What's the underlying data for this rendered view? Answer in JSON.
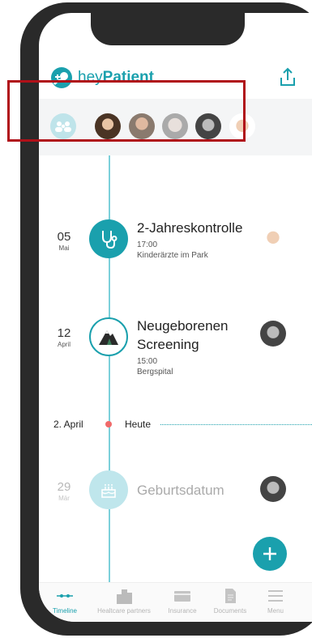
{
  "app": {
    "brand_prefix": "hey",
    "brand_bold": "Patient"
  },
  "header": {
    "share_icon": "share-icon"
  },
  "profiles": [
    {
      "name": "family",
      "icon": "family-icon"
    },
    {
      "name": "profile-1"
    },
    {
      "name": "profile-2"
    },
    {
      "name": "profile-3"
    },
    {
      "name": "profile-4"
    },
    {
      "name": "profile-5"
    }
  ],
  "timeline": {
    "events": [
      {
        "day": "05",
        "month": "Mai",
        "icon": "stethoscope-icon",
        "title": "2-Jahreskontrolle",
        "time": "17:00",
        "place": "Kinderärzte im Park"
      },
      {
        "day": "12",
        "month": "April",
        "icon": "mountain-icon",
        "title_line1": "Neugeborenen",
        "title_line2": "Screening",
        "time": "15:00",
        "place": "Bergspital"
      },
      {
        "day": "29",
        "month": "Mär",
        "icon": "cake-icon",
        "title": "Geburtsdatum"
      }
    ],
    "today": {
      "date": "2. April",
      "label": "Heute"
    }
  },
  "tabs": [
    {
      "label": "Timeline",
      "icon": "timeline-icon",
      "active": true
    },
    {
      "label": "Healtcare partners",
      "icon": "buildings-icon"
    },
    {
      "label": "Insurance",
      "icon": "card-icon"
    },
    {
      "label": "Documents",
      "icon": "document-icon"
    },
    {
      "label": "Menu",
      "icon": "menu-icon"
    }
  ],
  "colors": {
    "accent": "#1aa0ad",
    "highlight": "#b01018",
    "today_dot": "#f06a6a"
  }
}
